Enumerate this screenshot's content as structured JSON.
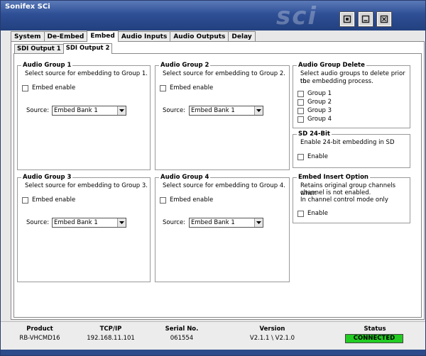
{
  "window": {
    "title": "Sonifex SCi",
    "logo_text": "sci",
    "buttons": {
      "restore": "restore-icon",
      "minimize": "minimize-icon",
      "close": "close-icon"
    }
  },
  "tabs": [
    {
      "label": "System"
    },
    {
      "label": "De-Embed"
    },
    {
      "label": "Embed"
    },
    {
      "label": "Audio Inputs"
    },
    {
      "label": "Audio Outputs"
    },
    {
      "label": "Delay"
    }
  ],
  "subtabs": [
    {
      "label": "SDI Output 1"
    },
    {
      "label": "SDI Output 2"
    }
  ],
  "audio_groups": [
    {
      "title": "Audio Group 1",
      "desc": "Select source for embedding to Group 1.",
      "embed_label": "Embed enable",
      "source_label": "Source:",
      "source_value": "Embed Bank 1"
    },
    {
      "title": "Audio Group 2",
      "desc": "Select source for embedding to Group 2.",
      "embed_label": "Embed enable",
      "source_label": "Source:",
      "source_value": "Embed Bank 1"
    },
    {
      "title": "Audio Group 3",
      "desc": "Select source for embedding to Group 3.",
      "embed_label": "Embed enable",
      "source_label": "Source:",
      "source_value": "Embed Bank 1"
    },
    {
      "title": "Audio Group 4",
      "desc": "Select source for embedding to Group 4.",
      "embed_label": "Embed enable",
      "source_label": "Source:",
      "source_value": "Embed Bank 1"
    }
  ],
  "group_delete": {
    "title": "Audio Group Delete",
    "desc1": "Select audio groups to delete prior to",
    "desc2": "the embedding process.",
    "items": [
      "Group 1",
      "Group 2",
      "Group 3",
      "Group 4"
    ]
  },
  "sd24": {
    "title": "SD 24-Bit",
    "desc": "Enable 24-bit embedding in SD",
    "enable_label": "Enable"
  },
  "insert_option": {
    "title": "Embed Insert Option",
    "desc1": "Retains original group channels when",
    "desc2": "channel is not enabled.",
    "desc3": "In channel control mode only",
    "enable_label": "Enable"
  },
  "status_bar": {
    "product": {
      "label": "Product",
      "value": "RB-VHCMD16"
    },
    "tcpip": {
      "label": "TCP/IP",
      "value": "192.168.11.101"
    },
    "serial": {
      "label": "Serial No.",
      "value": "061554"
    },
    "version": {
      "label": "Version",
      "value": "V2.1.1 \\ V2.1.0"
    },
    "status": {
      "label": "Status",
      "value": "CONNECTED"
    }
  },
  "colors": {
    "title_bar": "#2f4f96",
    "status_connected": "#22cc22"
  }
}
